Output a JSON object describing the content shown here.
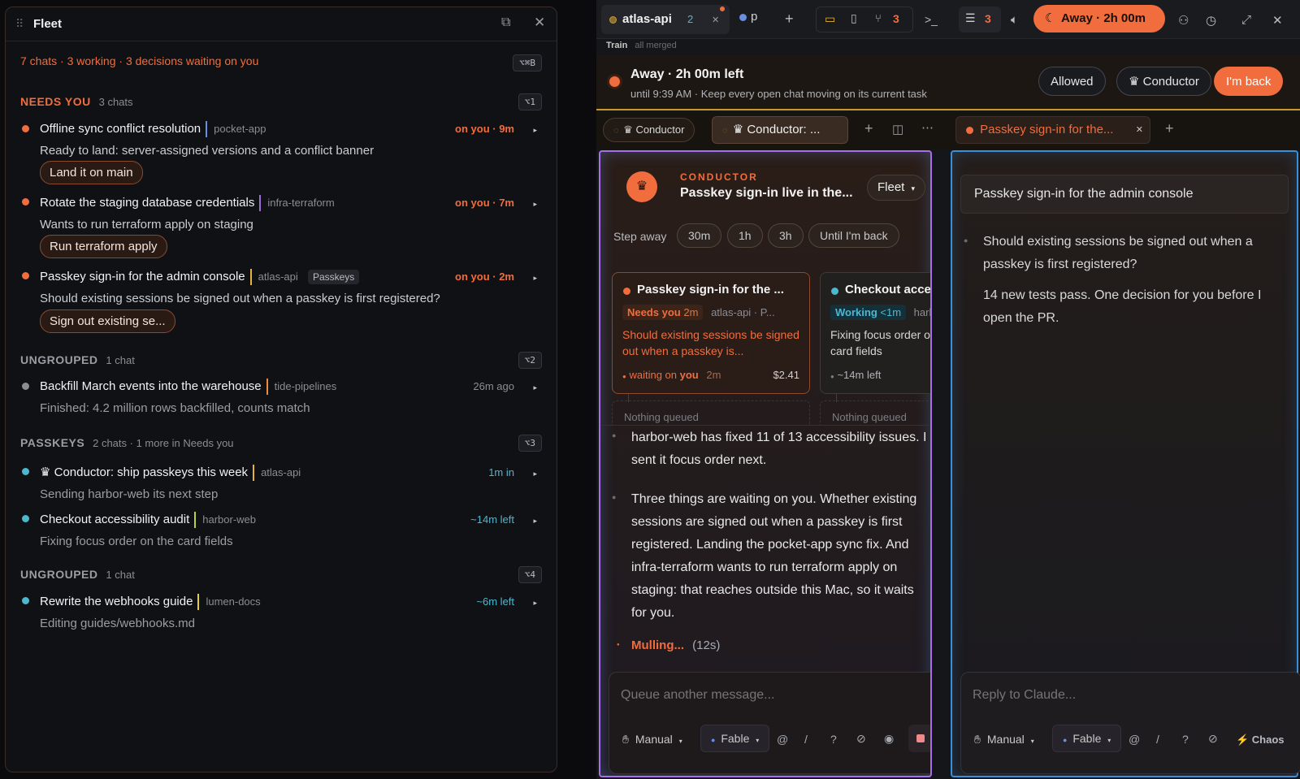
{
  "fleet": {
    "title": "Fleet",
    "summary": "7 chats · 3 working · 3 decisions waiting on you",
    "shortcut_main": "⌥⌘B",
    "groups": [
      {
        "label": "NEEDS YOU",
        "count": "3 chats",
        "shortcut": "⌥1",
        "items": [
          {
            "title": "Offline sync conflict resolution",
            "repo": "pocket-app",
            "status": "on you · 9m",
            "desc": "Ready to land: server-assigned versions and a conflict banner",
            "action": "Land it on main",
            "bar_color": "#6a8ee0"
          },
          {
            "title": "Rotate the staging database credentials",
            "repo": "infra-terraform",
            "status": "on you · 7m",
            "desc": "Wants to run terraform apply on staging",
            "action": "Run terraform apply",
            "bar_color": "#9b6fd6"
          },
          {
            "title": "Passkey sign-in for the admin console",
            "repo": "atlas-api",
            "tag": "Passkeys",
            "status": "on you · 2m",
            "desc": "Should existing sessions be signed out when a passkey is first registered?",
            "action": "Sign out existing se...",
            "bar_color": "#e3b33a"
          }
        ]
      },
      {
        "label": "UNGROUPED",
        "count": "1 chat",
        "shortcut": "⌥2",
        "items": [
          {
            "title": "Backfill March events into the warehouse",
            "repo": "tide-pipelines",
            "status": "26m ago",
            "desc": "Finished: 4.2 million rows backfilled, counts match",
            "bar_color": "#f08a3c"
          }
        ]
      },
      {
        "label": "PASSKEYS",
        "count": "2 chats · 1 more in Needs you",
        "shortcut": "⌥3",
        "items": [
          {
            "title": "♛ Conductor: ship passkeys this week",
            "repo": "atlas-api",
            "status": "1m in",
            "desc": "Sending harbor-web its next step",
            "bar_color": "#e3b33a"
          },
          {
            "title": "Checkout accessibility audit",
            "repo": "harbor-web",
            "status": "~14m left",
            "desc": "Fixing focus order on the card fields",
            "bar_color": "#b8d23a"
          }
        ]
      },
      {
        "label": "UNGROUPED",
        "count": "1 chat",
        "shortcut": "⌥4",
        "items": [
          {
            "title": "Rewrite the webhooks guide",
            "repo": "lumen-docs",
            "status": "~6m left",
            "desc": "Editing guides/webhooks.md",
            "bar_color": "#e3d03a"
          }
        ]
      }
    ]
  },
  "topbar": {
    "tab_title": "atlas-api",
    "tab_count": "2",
    "tab2_label": "p",
    "branch_count": "3",
    "list_count": "3",
    "away_label": "Away · 2h 00m",
    "train_label": "Train",
    "train_status": "all merged"
  },
  "away_banner": {
    "title": "Away · 2h 00m left",
    "subtitle": "until 9:39 AM · Keep every open chat moving on its current task",
    "allowed": "Allowed",
    "conductor": "♛ Conductor",
    "back": "I'm back"
  },
  "pane_tabs": {
    "left1": "♛ Conductor",
    "left2": "♛ Conductor: ...",
    "right1": "Passkey sign-in for the..."
  },
  "conductor": {
    "eyebrow": "CONDUCTOR",
    "title": "Passkey sign-in live in the...",
    "fleet_btn": "Fleet",
    "step_away": "Step away",
    "chips": [
      "30m",
      "1h",
      "3h",
      "Until I'm back"
    ],
    "card1": {
      "title": "Passkey sign-in for the ...",
      "badge": "Needs you",
      "badge_time": "2m",
      "repo": "atlas-api · P...",
      "body": "Should existing sessions be signed out when a passkey is...",
      "waiting_on": "waiting on",
      "waiting_you": "you",
      "waiting_time": "2m",
      "cost": "$2.41",
      "queue": "Nothing queued"
    },
    "card2": {
      "title": "Checkout acces",
      "badge": "Working",
      "badge_time": "<1m",
      "repo": "harb",
      "body": "Fixing focus order on card fields",
      "left": "~14m left",
      "queue": "Nothing queued"
    },
    "messages": [
      "harbor-web has fixed 11 of 13 accessibility issues. I sent it focus order next.",
      "Three things are waiting on you. Whether existing sessions are signed out when a passkey is first registered. Landing the pocket-app sync fix. And infra-terraform wants to run terraform apply on staging: that reaches outside this Mac, so it waits for you."
    ],
    "mulling": "Mulling...",
    "mulling_time": "(12s)",
    "input_placeholder": "Queue another message...",
    "mode": "Manual",
    "model": "Fable"
  },
  "passkey": {
    "title": "Passkey sign-in for the admin console",
    "question": "Should existing sessions be signed out when a passkey is first registered?",
    "note": "14 new tests pass. One decision for you before I open the PR.",
    "input_placeholder": "Reply to Claude...",
    "mode": "Manual",
    "model": "Fable",
    "chaos": "⚡ Chaos"
  },
  "colors": {
    "accent": "#f26d3d",
    "teal": "#4cb8cf",
    "conductor_border": "#a86fe6",
    "passkey_border": "#3b8fd9"
  }
}
